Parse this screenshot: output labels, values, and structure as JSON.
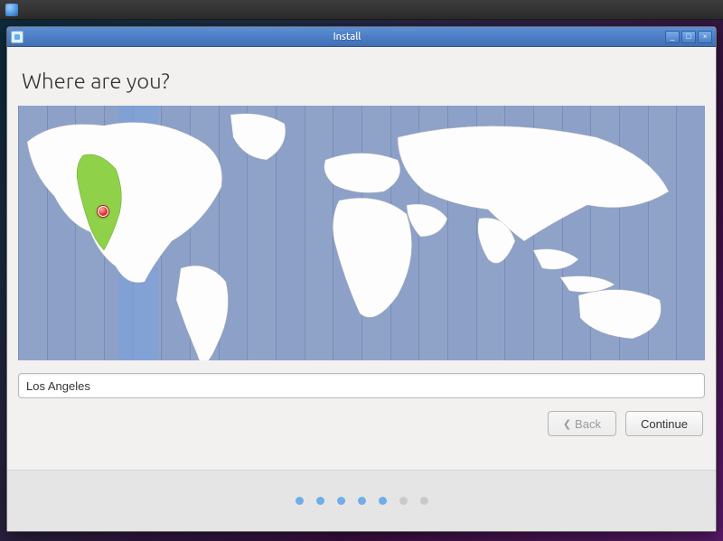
{
  "menubar": {
    "sys_icon": "system-menu-icon"
  },
  "window": {
    "title": "Install",
    "controls": {
      "minimize": "_",
      "maximize": "□",
      "close": "×"
    }
  },
  "page": {
    "heading": "Where are you?",
    "location_value": "Los Angeles",
    "timezone_band_index": 4,
    "pin": {
      "left_pct": 12.4,
      "top_pct": 41.5
    }
  },
  "buttons": {
    "back_label": "Back",
    "back_disabled": true,
    "continue_label": "Continue"
  },
  "progress": {
    "total": 7,
    "current": 5
  },
  "colors": {
    "accent": "#4a90d9",
    "highlight_green": "#8fd24a",
    "map_bg": "#8ca0c8"
  }
}
